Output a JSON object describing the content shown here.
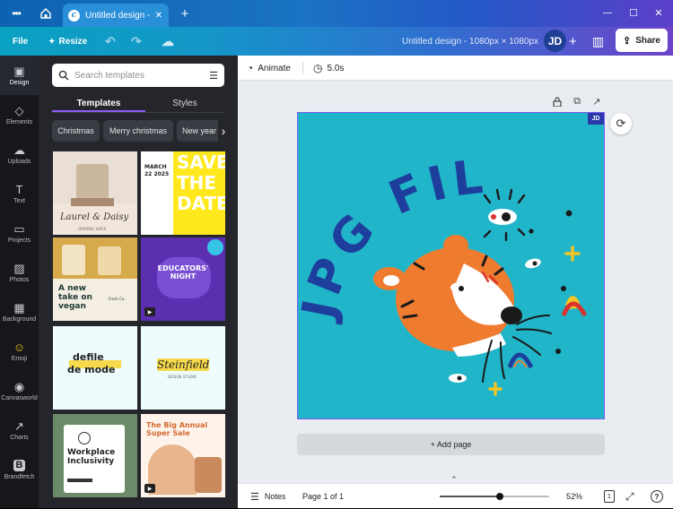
{
  "titlebar": {
    "menu_icon": "more-dots-icon",
    "home_icon": "home-icon",
    "tab_title": "Untitled design - 1...",
    "close_glyph": "✕",
    "new_tab_glyph": "+",
    "min_glyph": "—",
    "max_glyph": "☐",
    "close_window_glyph": "✕"
  },
  "toolbar": {
    "file": "File",
    "resize": "Resize",
    "undo_glyph": "↶",
    "redo_glyph": "↷",
    "cloud_glyph": "☁",
    "doc_title": "Untitled design - 1080px × 1080px",
    "avatar": "JD",
    "add_glyph": "+",
    "chart_glyph": "▥",
    "share": "Share",
    "share_glyph": "⇪"
  },
  "rail": [
    {
      "label": "Design",
      "glyph": "▣"
    },
    {
      "label": "Elements",
      "glyph": "◇"
    },
    {
      "label": "Uploads",
      "glyph": "☁"
    },
    {
      "label": "Text",
      "glyph": "T"
    },
    {
      "label": "Projects",
      "glyph": "▭"
    },
    {
      "label": "Photos",
      "glyph": "▨"
    },
    {
      "label": "Background",
      "glyph": "▦"
    },
    {
      "label": "Emoji",
      "glyph": "☺"
    },
    {
      "label": "Canvasworld",
      "glyph": "◉"
    },
    {
      "label": "Charts",
      "glyph": "↗"
    },
    {
      "label": "Brandfetch",
      "glyph": "B"
    }
  ],
  "panel": {
    "search_placeholder": "Search templates",
    "filter_glyph": "☰",
    "tab_templates": "Templates",
    "tab_styles": "Styles",
    "chips": [
      "Christmas",
      "Merry christmas",
      "New year"
    ],
    "chip_next": "›",
    "collapse_glyph": "‹",
    "thumbs": {
      "t1": "Laurel & Daisy",
      "t1b": "OPENING WEEK",
      "t2a": "SAVE",
      "t2b": "THE",
      "t2c": "DATE",
      "t2d": "MARCH 22 2025",
      "t3a": "A new take on vegan",
      "t3b": "Fresh Co.",
      "t4a": "EDUCATORS' NIGHT",
      "t5a": "defile",
      "t5b": "de mode",
      "t6a": "Steinfield",
      "t6b": "DESIGN STUDIO",
      "t7a": "Workplace Inclusivity",
      "t8a": "The Big Annual Super Sale"
    }
  },
  "context": {
    "animate": "Animate",
    "duration": "5.0s"
  },
  "canvas": {
    "headline": "JPG FILE",
    "owner_badge": "JD",
    "lock_glyph": "🔒",
    "dup_glyph": "⧉",
    "share_glyph": "↗",
    "refresh_glyph": "⟳",
    "colors": {
      "bg": "#21b5c9",
      "text": "#1d3e9c",
      "tiger": "#ef7b2f"
    }
  },
  "add_page": "+ Add page",
  "footer": {
    "notes": "Notes",
    "page": "Page 1 of 1",
    "zoom": "52%",
    "zoom_level": 0.55,
    "pages_badge": "1",
    "help_glyph": "?",
    "expand_glyph": "⤢",
    "up_glyph": "⌃"
  }
}
